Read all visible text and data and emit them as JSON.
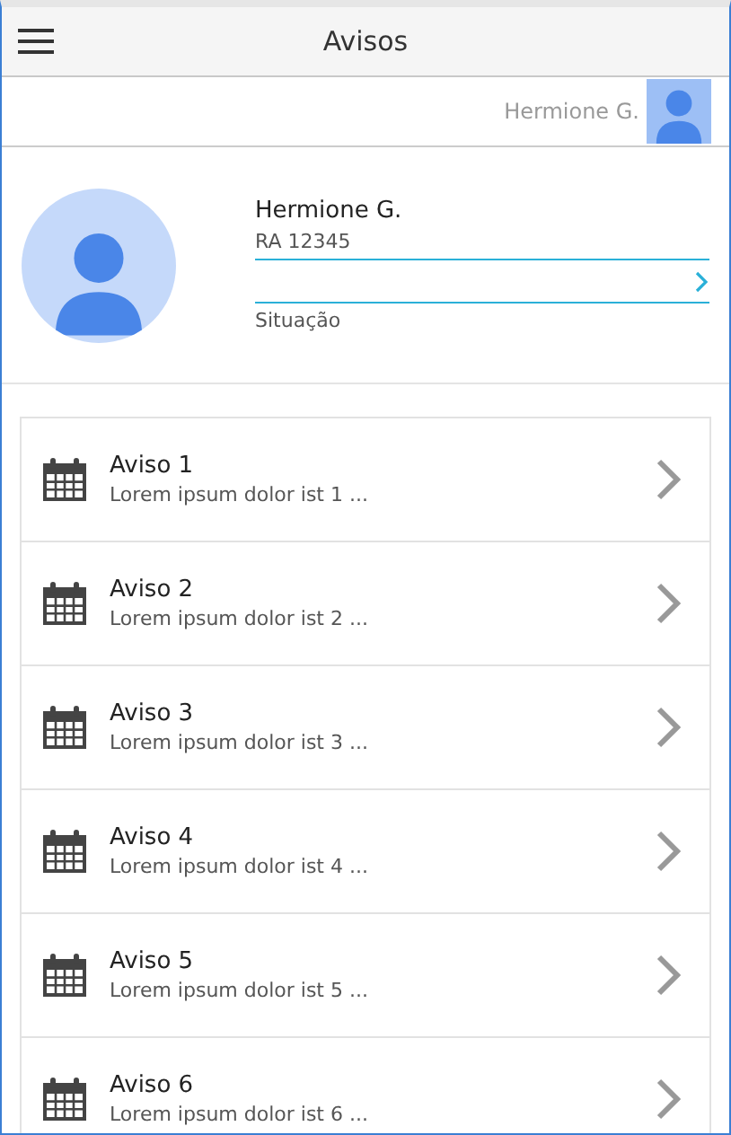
{
  "header": {
    "title": "Avisos"
  },
  "user_bar": {
    "name": "Hermione G."
  },
  "profile": {
    "name": "Hermione G.",
    "ra": "RA 12345",
    "status_label": "Situação"
  },
  "notices": [
    {
      "title": "Aviso 1",
      "summary": "Lorem ipsum dolor ist 1 ..."
    },
    {
      "title": "Aviso 2",
      "summary": "Lorem ipsum dolor ist 2 ..."
    },
    {
      "title": "Aviso 3",
      "summary": "Lorem ipsum dolor ist 3 ..."
    },
    {
      "title": "Aviso 4",
      "summary": "Lorem ipsum dolor ist 4 ..."
    },
    {
      "title": "Aviso 5",
      "summary": "Lorem ipsum dolor ist 5 ..."
    },
    {
      "title": "Aviso 6",
      "summary": "Lorem ipsum dolor ist 6 ..."
    }
  ]
}
